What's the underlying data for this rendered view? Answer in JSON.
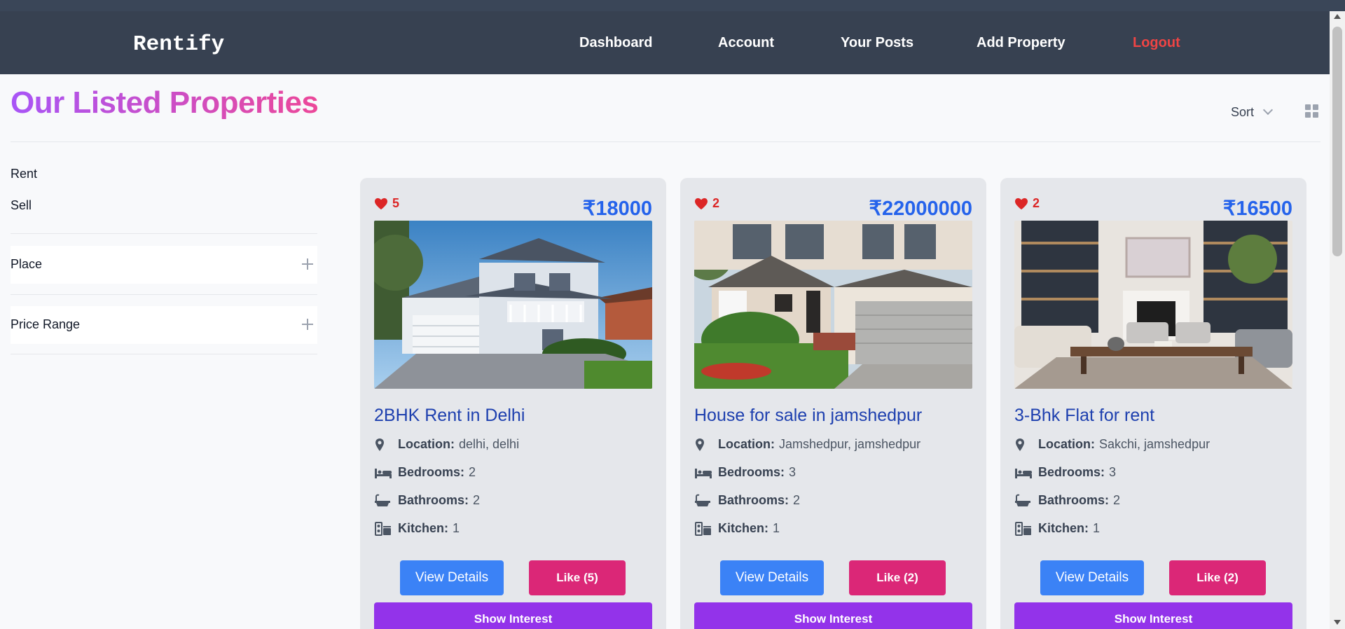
{
  "app": {
    "brand": "Rentify"
  },
  "nav": {
    "dashboard": "Dashboard",
    "account": "Account",
    "your_posts": "Your Posts",
    "add_property": "Add Property",
    "logout": "Logout"
  },
  "page": {
    "title": "Our Listed Properties",
    "sort_label": "Sort"
  },
  "filters": {
    "rent": "Rent",
    "sell": "Sell",
    "place": "Place",
    "price_range": "Price Range"
  },
  "labels": {
    "location": "Location:",
    "bedrooms": "Bedrooms:",
    "bathrooms": "Bathrooms:",
    "kitchen": "Kitchen:",
    "view_details": "View Details",
    "show_interest": "Show Interest"
  },
  "properties": [
    {
      "likes": "5",
      "price": "₹18000",
      "title": "2BHK Rent in Delhi",
      "location": "delhi, delhi",
      "bedrooms": "2",
      "bathrooms": "2",
      "kitchen": "1",
      "like_button": "Like (5)"
    },
    {
      "likes": "2",
      "price": "₹22000000",
      "title": "House for sale in jamshedpur",
      "location": "Jamshedpur, jamshedpur",
      "bedrooms": "3",
      "bathrooms": "2",
      "kitchen": "1",
      "like_button": "Like (2)"
    },
    {
      "likes": "2",
      "price": "₹16500",
      "title": "3-Bhk Flat for rent",
      "location": "Sakchi, jamshedpur",
      "bedrooms": "3",
      "bathrooms": "2",
      "kitchen": "1",
      "like_button": "Like (2)"
    }
  ],
  "colors": {
    "nav_bg": "#374151",
    "logout": "#ef4444",
    "title_gradient_start": "#a855f7",
    "title_gradient_end": "#ec4899",
    "price": "#2563eb",
    "view_button": "#3b82f6",
    "like_button": "#db2777",
    "interest_button": "#9333ea"
  },
  "icons": [
    "heart-icon",
    "map-pin-icon",
    "bed-icon",
    "bath-icon",
    "kitchen-icon",
    "chevron-down-icon",
    "grid-view-icon",
    "plus-icon"
  ]
}
